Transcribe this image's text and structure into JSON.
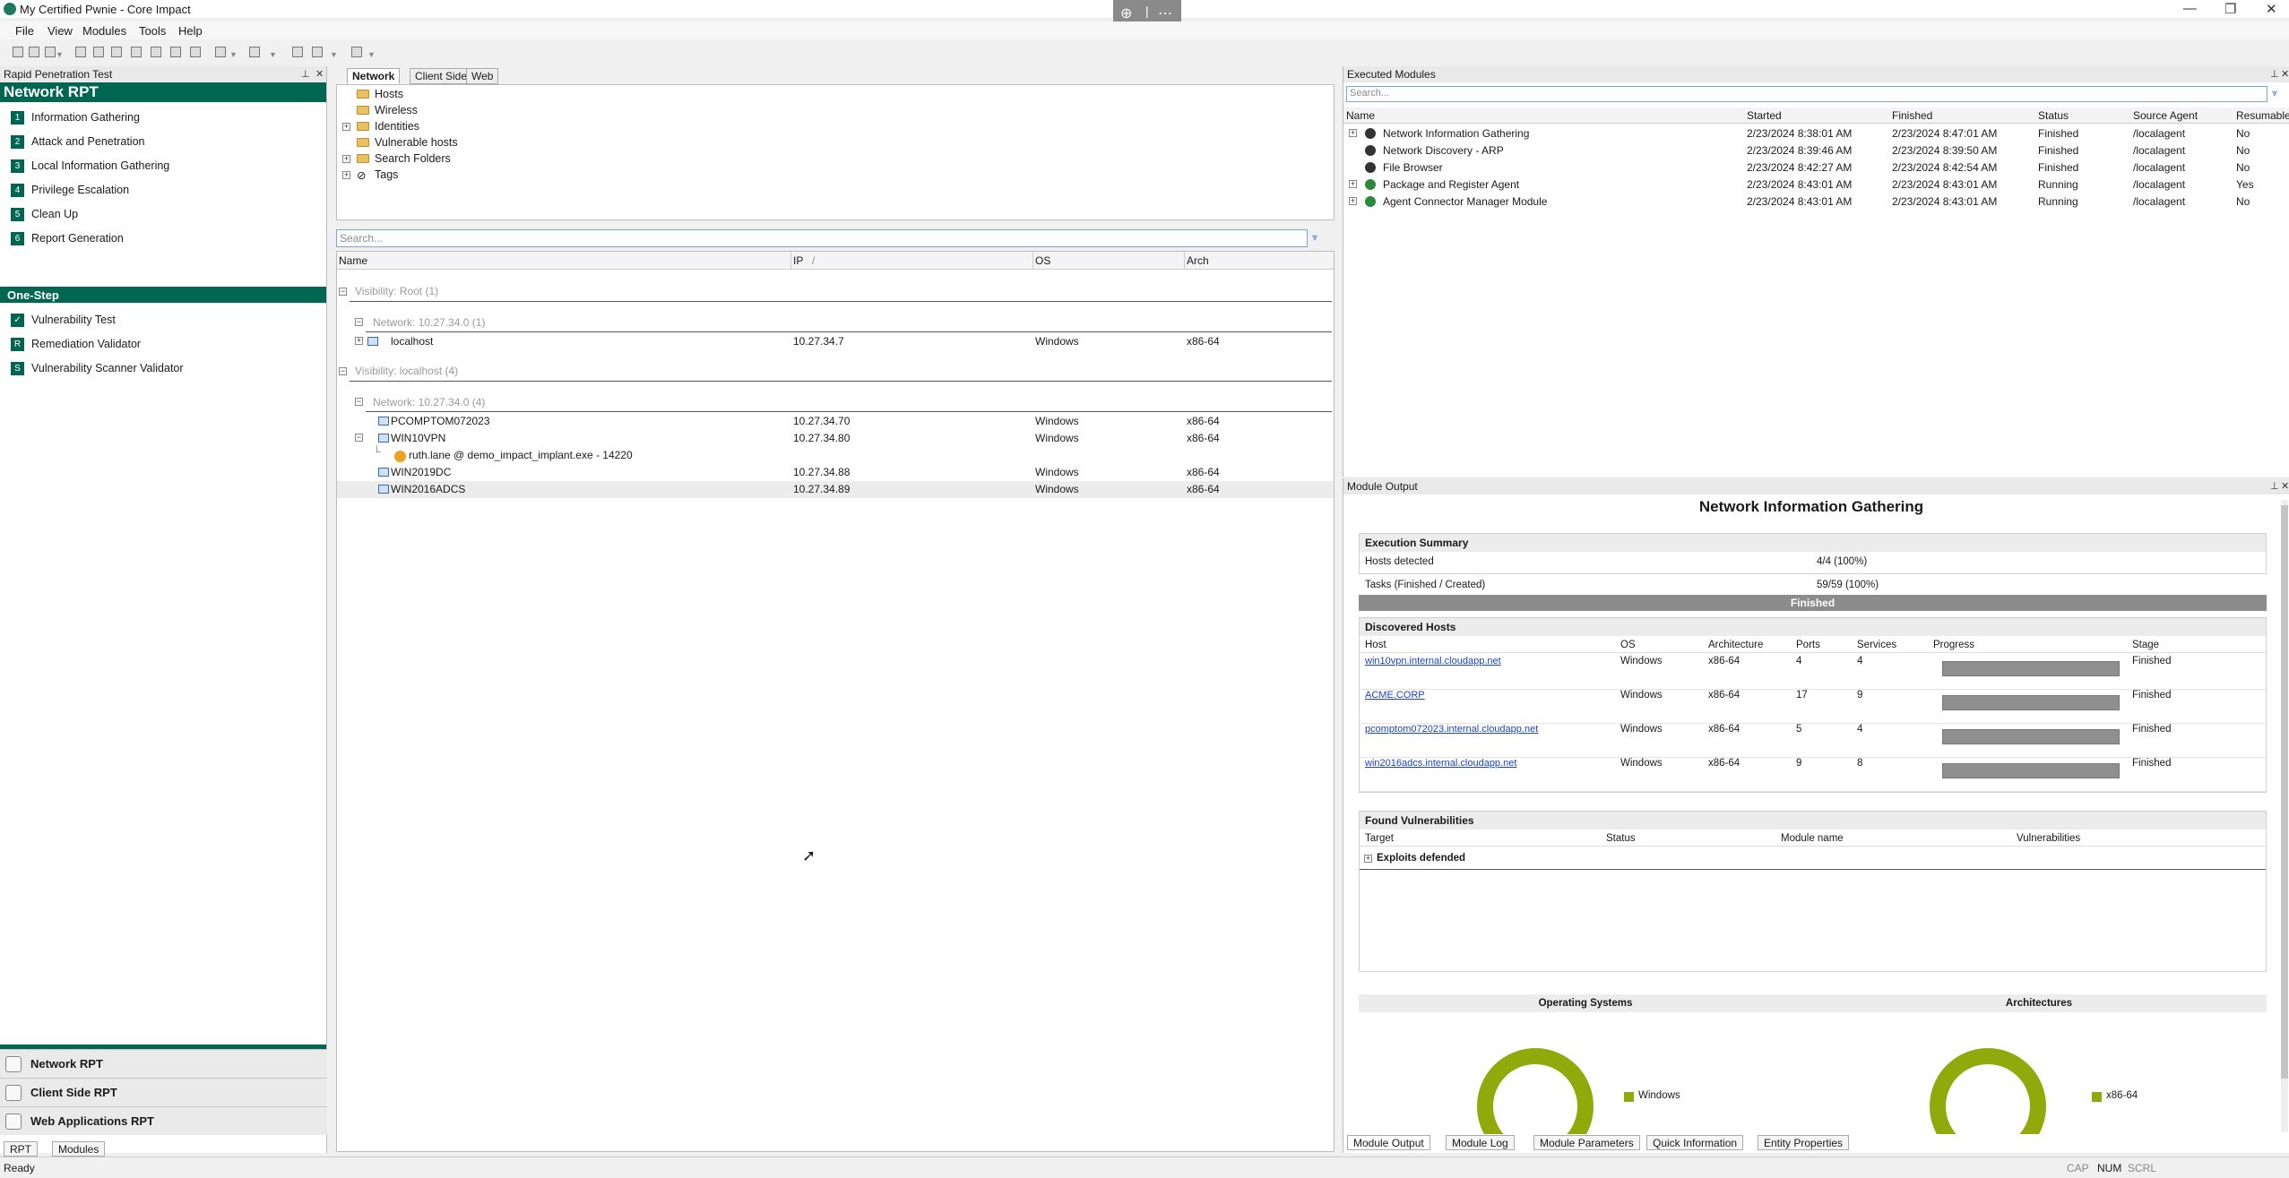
{
  "window": {
    "title": "My Certified Pwnie - Core Impact"
  },
  "menu": [
    "File",
    "View",
    "Modules",
    "Tools",
    "Help"
  ],
  "left_panel": {
    "header": "Rapid Penetration Test",
    "section_title": "Network RPT",
    "steps": [
      {
        "num": "1",
        "label": "Information Gathering"
      },
      {
        "num": "2",
        "label": "Attack and Penetration"
      },
      {
        "num": "3",
        "label": "Local Information Gathering"
      },
      {
        "num": "4",
        "label": "Privilege Escalation"
      },
      {
        "num": "5",
        "label": "Clean Up"
      },
      {
        "num": "6",
        "label": "Report Generation"
      }
    ],
    "onestep_title": "One-Step",
    "onestep": [
      {
        "num": "✓",
        "label": "Vulnerability Test"
      },
      {
        "num": "R",
        "label": "Remediation Validator"
      },
      {
        "num": "S",
        "label": "Vulnerability Scanner Validator"
      }
    ],
    "nav_tabs": [
      "Network RPT",
      "Client Side RPT",
      "Web Applications RPT"
    ],
    "bottom_tabs": [
      "RPT",
      "Modules"
    ]
  },
  "entity_view": {
    "tabs": [
      "Network",
      "Client Side",
      "Web"
    ],
    "tree": [
      "Hosts",
      "Wireless",
      "Identities",
      "Vulnerable hosts",
      "Search Folders",
      "Tags"
    ],
    "search_placeholder": "Search...",
    "columns": [
      "Name",
      "IP",
      "OS",
      "Arch"
    ],
    "groups": {
      "root_visibility": "Visibility: Root (1)",
      "root_network": "Network: 10.27.34.0 (1)",
      "local_visibility": "Visibility: localhost (4)",
      "local_network": "Network: 10.27.34.0 (4)"
    },
    "rows": [
      {
        "name": "localhost",
        "ip": "10.27.34.7",
        "os": "Windows",
        "arch": "x86-64"
      },
      {
        "name": "PCOMPTOM072023",
        "ip": "10.27.34.70",
        "os": "Windows",
        "arch": "x86-64"
      },
      {
        "name": "WIN10VPN",
        "ip": "10.27.34.80",
        "os": "Windows",
        "arch": "x86-64"
      },
      {
        "name": "ruth.lane @ demo_impact_implant.exe - 14220",
        "ip": "",
        "os": "",
        "arch": ""
      },
      {
        "name": "WIN2019DC",
        "ip": "10.27.34.88",
        "os": "Windows",
        "arch": "x86-64"
      },
      {
        "name": "WIN2016ADCS",
        "ip": "10.27.34.89",
        "os": "Windows",
        "arch": "x86-64"
      }
    ]
  },
  "executed_modules": {
    "header": "Executed Modules",
    "search_placeholder": "Search...",
    "columns": [
      "Name",
      "Started",
      "Finished",
      "Status",
      "Source Agent",
      "Resumable"
    ],
    "rows": [
      {
        "name": "Network Information Gathering",
        "started": "2/23/2024 8:38:01 AM",
        "finished": "2/23/2024 8:47:01 AM",
        "status": "Finished",
        "agent": "/localagent",
        "resumable": "No"
      },
      {
        "name": "Network Discovery - ARP",
        "started": "2/23/2024 8:39:46 AM",
        "finished": "2/23/2024 8:39:50 AM",
        "status": "Finished",
        "agent": "/localagent",
        "resumable": "No"
      },
      {
        "name": "File Browser",
        "started": "2/23/2024 8:42:27 AM",
        "finished": "2/23/2024 8:42:54 AM",
        "status": "Finished",
        "agent": "/localagent",
        "resumable": "No"
      },
      {
        "name": "Package and Register Agent",
        "started": "2/23/2024 8:43:01 AM",
        "finished": "2/23/2024 8:43:01 AM",
        "status": "Running",
        "agent": "/localagent",
        "resumable": "Yes"
      },
      {
        "name": "Agent Connector Manager Module",
        "started": "2/23/2024 8:43:01 AM",
        "finished": "2/23/2024 8:43:01 AM",
        "status": "Running",
        "agent": "/localagent",
        "resumable": "No"
      }
    ]
  },
  "module_output": {
    "header": "Module Output",
    "title": "Network Information Gathering",
    "exec_summary": {
      "title": "Execution Summary",
      "rows": [
        {
          "label": "Hosts detected",
          "value": "4/4 (100%)"
        },
        {
          "label": "Tasks (Finished / Created)",
          "value": "59/59 (100%)"
        }
      ],
      "bar": "Finished"
    },
    "discovered": {
      "title": "Discovered Hosts",
      "columns": [
        "Host",
        "OS",
        "Architecture",
        "Ports",
        "Services",
        "Progress",
        "Stage"
      ],
      "rows": [
        {
          "host": "win10vpn.internal.cloudapp.net",
          "os": "Windows",
          "arch": "x86-64",
          "ports": "4",
          "services": "4",
          "progress": 1.0,
          "stage": "Finished"
        },
        {
          "host": "ACME.CORP",
          "os": "Windows",
          "arch": "x86-64",
          "ports": "17",
          "services": "9",
          "progress": 1.0,
          "stage": "Finished"
        },
        {
          "host": "pcomptom072023.internal.cloudapp.net",
          "os": "Windows",
          "arch": "x86-64",
          "ports": "5",
          "services": "4",
          "progress": 1.0,
          "stage": "Finished"
        },
        {
          "host": "win2016adcs.internal.cloudapp.net",
          "os": "Windows",
          "arch": "x86-64",
          "ports": "9",
          "services": "8",
          "progress": 1.0,
          "stage": "Finished"
        }
      ]
    },
    "vulns": {
      "title": "Found Vulnerabilities",
      "columns": [
        "Target",
        "Status",
        "Module name",
        "Vulnerabilities"
      ],
      "group": "Exploits defended"
    },
    "os_title": "Operating Systems",
    "arch_title": "Architectures",
    "os_legend": "Windows",
    "arch_legend": "x86-64",
    "tabs": [
      "Module Output",
      "Module Log",
      "Module Parameters",
      "Quick Information",
      "Entity Properties"
    ]
  },
  "status": {
    "left": "Ready",
    "indicators": [
      "CAP",
      "NUM",
      "SCRL"
    ]
  },
  "colors": {
    "brand_green": "#006652",
    "chart_green": "#8faa0a"
  }
}
